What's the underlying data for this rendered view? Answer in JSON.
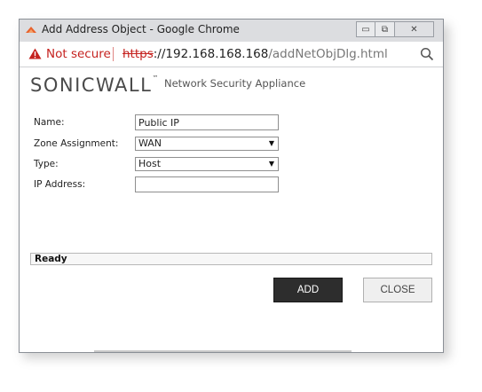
{
  "window": {
    "title": "Add Address Object - Google Chrome",
    "minimize_glyph": "▭",
    "restore_glyph": "⧉",
    "close_glyph": "✕"
  },
  "addressbar": {
    "security_text": "Not secure",
    "url_scheme": "https",
    "url_sep": "://",
    "url_host": "192.168.168.168",
    "url_path": "/addNetObjDlg.html"
  },
  "header": {
    "logo_left": "SONIC",
    "logo_right": "WALL",
    "logo_tm": "™",
    "subtitle": "Network Security Appliance"
  },
  "form": {
    "name_label": "Name:",
    "name_value": "Public IP",
    "zone_label": "Zone Assignment:",
    "zone_value": "WAN",
    "type_label": "Type:",
    "type_value": "Host",
    "ip_label": "IP Address:",
    "ip_value": ""
  },
  "status": {
    "text": "Ready"
  },
  "buttons": {
    "add_label": "ADD",
    "close_label": "CLOSE"
  },
  "icons": {
    "chrome": "chrome-icon",
    "warning": "warning-icon",
    "zoom": "zoom-icon",
    "dropdown": "chevron-down-icon"
  },
  "colors": {
    "insecure": "#c5221f",
    "add_button": "#2d2d2d"
  }
}
